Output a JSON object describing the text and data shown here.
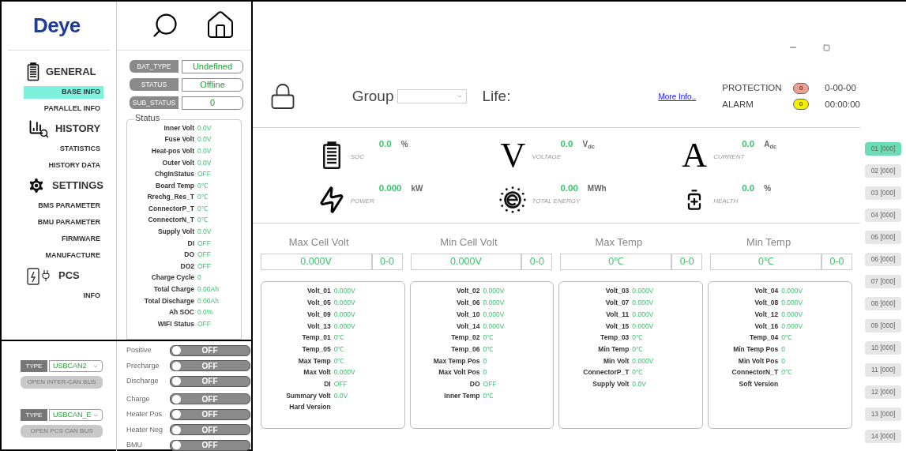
{
  "sidebar": {
    "logo": "Deye",
    "sections": [
      {
        "title": "GENERAL",
        "items": [
          {
            "label": "BASE INFO",
            "selected": true
          },
          {
            "label": "PARALLEL INFO",
            "selected": false
          }
        ]
      },
      {
        "title": "HISTORY",
        "items": [
          {
            "label": "STATISTICS",
            "selected": false
          },
          {
            "label": "HISTORY DATA",
            "selected": false
          }
        ]
      },
      {
        "title": "SETTINGS",
        "items": [
          {
            "label": "BMS PARAMETER",
            "selected": false
          },
          {
            "label": "BMU PARAMETER",
            "selected": false
          },
          {
            "label": "FIRMWARE",
            "selected": false
          },
          {
            "label": "MANUFACTURE",
            "selected": false
          }
        ]
      },
      {
        "title": "PCS",
        "items": [
          {
            "label": "INFO",
            "selected": false
          }
        ]
      }
    ]
  },
  "base_info": {
    "fields": [
      {
        "label": "BAT_TYPE",
        "value": "Undefined"
      },
      {
        "label": "STATUS",
        "value": "Offline"
      },
      {
        "label": "SUB_STATUS",
        "value": "0"
      }
    ],
    "status_title": "Status",
    "status_rows": [
      {
        "label": "Inner Volt",
        "value": "0.0V"
      },
      {
        "label": "Fuse Volt",
        "value": "0.0V"
      },
      {
        "label": "Heat-pos Volt",
        "value": "0.0V"
      },
      {
        "label": "Outer Volt",
        "value": "0.0V"
      },
      {
        "label": "ChgInStatus",
        "value": "OFF"
      },
      {
        "label": "Board Temp",
        "value": "0℃"
      },
      {
        "label": "Rrechg_Res_T",
        "value": "0℃"
      },
      {
        "label": "ConnectorP_T",
        "value": "0℃"
      },
      {
        "label": "ConnectorN_T",
        "value": "0℃"
      },
      {
        "label": "Supply Volt",
        "value": "0.0V"
      },
      {
        "label": "DI",
        "value": "OFF"
      },
      {
        "label": "DO",
        "value": "OFF"
      },
      {
        "label": "DO2",
        "value": "OFF"
      },
      {
        "label": "Charge Cycle",
        "value": "0"
      },
      {
        "label": "Total Charge",
        "value": "0.00Ah"
      },
      {
        "label": "Total Discharge",
        "value": "0.00Ah"
      },
      {
        "label": "Ah SOC",
        "value": "0.0%"
      },
      {
        "label": "WIFI Status",
        "value": "OFF"
      }
    ]
  },
  "can_bus": [
    {
      "type_label": "TYPE",
      "type_value": "USBCAN2",
      "button": "OPEN INTER-CAN BUS"
    },
    {
      "type_label": "TYPE",
      "type_value": "USBCAN_E",
      "button": "OPEN PCS CAN BUS"
    }
  ],
  "relays": [
    {
      "label": "Positive",
      "state": "OFF",
      "on": false
    },
    {
      "label": "Precharge",
      "state": "OFF",
      "on": false
    },
    {
      "label": "Discharge",
      "state": "OFF",
      "on": false
    },
    {
      "label": "Charge",
      "state": "OFF",
      "on": false
    },
    {
      "label": "Heater Pos",
      "state": "OFF",
      "on": false
    },
    {
      "label": "Heater Neg",
      "state": "OFF",
      "on": false
    },
    {
      "label": "BMU",
      "state": "OFF",
      "on": false
    }
  ],
  "header": {
    "group_label": "Group",
    "life_label": "Life:",
    "link": "More Info..",
    "protection": {
      "label": "PROTECTION",
      "count": "0",
      "color": "#f0a090"
    },
    "alarm": {
      "label": "ALARM",
      "count": "0",
      "color": "#f4f000"
    },
    "date": "0-00-00",
    "time": "00:00:00"
  },
  "metrics": [
    {
      "value": "0.0",
      "unit": "%",
      "caption": "SOC"
    },
    {
      "symbol": "V",
      "value": "0.0",
      "unit": "V$_{dc}$",
      "caption": "VOLTAGE"
    },
    {
      "symbol": "A",
      "value": "0.0",
      "unit": "A$_{dc}$",
      "caption": "CURRENT"
    },
    {
      "value": "0.000",
      "unit": "kW",
      "caption": "POWER"
    },
    {
      "value": "0.00",
      "unit": "MWh",
      "caption": "TOTAL ENERGY"
    },
    {
      "value": "0.0",
      "unit": "%",
      "caption": "HEALTH"
    }
  ],
  "extremes": [
    {
      "title": "Max Cell Volt",
      "value": "0.000V",
      "position": "0-0"
    },
    {
      "title": "Min Cell Volt",
      "value": "0.000V",
      "position": "0-0"
    },
    {
      "title": "Max Temp",
      "value": "0℃",
      "position": "0-0"
    },
    {
      "title": "Min Temp",
      "value": "0℃",
      "position": "0-0"
    }
  ],
  "cards": [
    [
      {
        "label": "Volt_01",
        "value": "0.000V"
      },
      {
        "label": "Volt_05",
        "value": "0.000V"
      },
      {
        "label": "Volt_09",
        "value": "0.000V"
      },
      {
        "label": "Volt_13",
        "value": "0.000V"
      },
      {
        "label": "Temp_01",
        "value": "0℃"
      },
      {
        "label": "Temp_05",
        "value": "0℃"
      },
      {
        "label": "Max Temp",
        "value": "0℃"
      },
      {
        "label": "Max Volt",
        "value": "0.000V"
      },
      {
        "label": "DI",
        "value": "OFF"
      },
      {
        "label": "Summary Volt",
        "value": "0.0V"
      },
      {
        "label": "Hard Version"
      }
    ],
    [
      {
        "label": "Volt_02",
        "value": "0.000V"
      },
      {
        "label": "Volt_06",
        "value": "0.000V"
      },
      {
        "label": "Volt_10",
        "value": "0.000V"
      },
      {
        "label": "Volt_14",
        "value": "0.000V"
      },
      {
        "label": "Temp_02",
        "value": "0℃"
      },
      {
        "label": "Temp_06",
        "value": "0℃"
      },
      {
        "label": "Max Temp Pos",
        "value": "0"
      },
      {
        "label": "Max Volt Pos",
        "value": "0"
      },
      {
        "label": "DO",
        "value": "OFF"
      },
      {
        "label": "Inner Temp",
        "value": "0℃"
      }
    ],
    [
      {
        "label": "Volt_03",
        "value": "0.000V"
      },
      {
        "label": "Volt_07",
        "value": "0.000V"
      },
      {
        "label": "Volt_11",
        "value": "0.000V"
      },
      {
        "label": "Volt_15",
        "value": "0.000V"
      },
      {
        "label": "Temp_03",
        "value": "0℃"
      },
      {
        "label": "Min Temp",
        "value": "0℃"
      },
      {
        "label": "Min Volt",
        "value": "0.000V"
      },
      {
        "label": "ConnectorP_T",
        "value": "0℃"
      },
      {
        "label": "Supply Volt",
        "value": "0.0V"
      }
    ],
    [
      {
        "label": "Volt_04",
        "value": "0.000V"
      },
      {
        "label": "Volt_08",
        "value": "0.000V"
      },
      {
        "label": "Volt_12",
        "value": "0.000V"
      },
      {
        "label": "Volt_16",
        "value": "0.000V"
      },
      {
        "label": "Temp_04",
        "value": "0℃"
      },
      {
        "label": "Min Temp Pos",
        "value": "0"
      },
      {
        "label": "Min Volt Pos",
        "value": "0"
      },
      {
        "label": "ConnectorN_T",
        "value": "0℃"
      },
      {
        "label": "Soft Version"
      }
    ]
  ],
  "packs": [
    {
      "label": "01 [000]",
      "selected": true
    },
    {
      "label": "02 [000]",
      "selected": false
    },
    {
      "label": "03 [000]",
      "selected": false
    },
    {
      "label": "04 [000]",
      "selected": false
    },
    {
      "label": "05 [000]",
      "selected": false
    },
    {
      "label": "06 [000]",
      "selected": false
    },
    {
      "label": "07 [000]",
      "selected": false
    },
    {
      "label": "08 [000]",
      "selected": false
    },
    {
      "label": "09 [000]",
      "selected": false
    },
    {
      "label": "10 [000]",
      "selected": false
    },
    {
      "label": "11 [000]",
      "selected": false
    },
    {
      "label": "12 [000]",
      "selected": false
    },
    {
      "label": "13 [000]",
      "selected": false
    },
    {
      "label": "14 [000]",
      "selected": false
    }
  ]
}
